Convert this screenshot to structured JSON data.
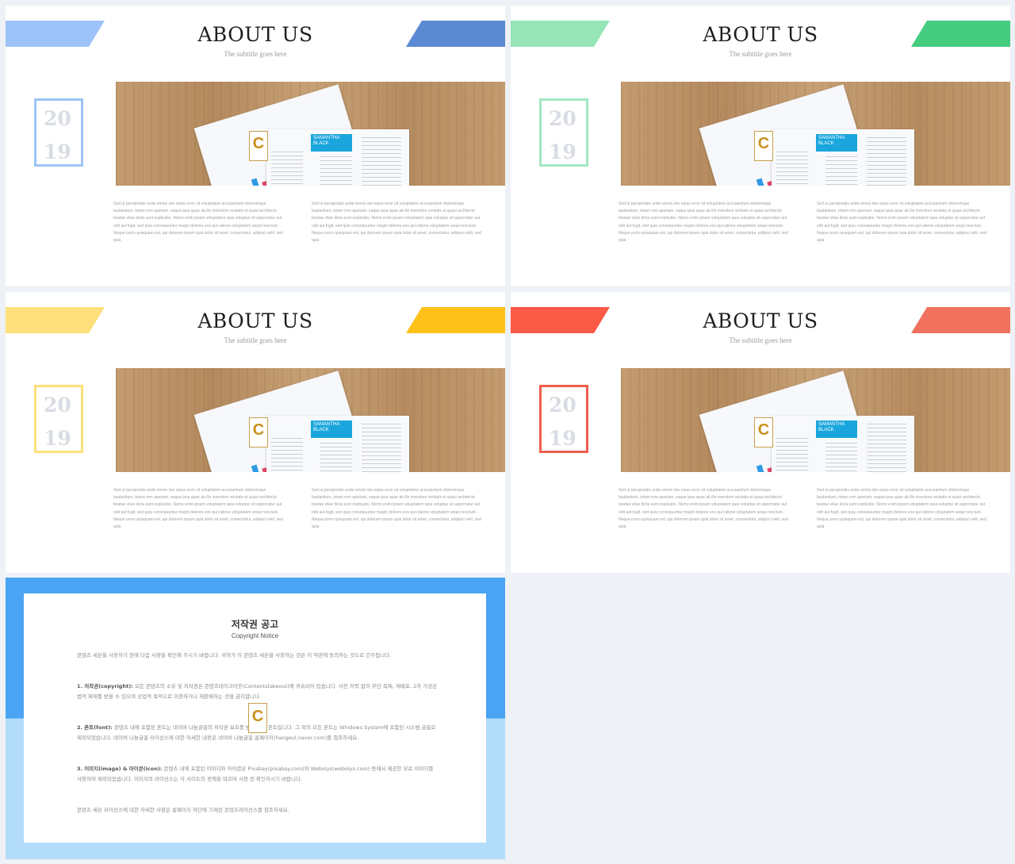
{
  "slides": [
    {
      "title": "ABOUT US",
      "subtitle": "The subtitle goes here",
      "year_top": "20",
      "year_bottom": "19",
      "tab_left_color": "#9ec3f8",
      "tab_right_color": "#5b8ad3",
      "year_border_color": "#9ec3f8"
    },
    {
      "title": "ABOUT US",
      "subtitle": "The subtitle goes here",
      "year_top": "20",
      "year_bottom": "19",
      "tab_left_color": "#96e6b8",
      "tab_right_color": "#45cc7f",
      "year_border_color": "#a3e7c0"
    },
    {
      "title": "ABOUT US",
      "subtitle": "The subtitle goes here",
      "year_top": "20",
      "year_bottom": "19",
      "tab_left_color": "#fde07a",
      "tab_right_color": "#fec11a",
      "year_border_color": "#fde07a"
    },
    {
      "title": "ABOUT US",
      "subtitle": "The subtitle goes here",
      "year_top": "20",
      "year_bottom": "19",
      "tab_left_color": "#fb5a46",
      "tab_right_color": "#f0725e",
      "year_border_color": "#ef5e4c"
    }
  ],
  "photo": {
    "resume_name": "SAMANTHA BLACK",
    "logo_letter": "C"
  },
  "body_text": {
    "left": "Sed ut perspiciatis unde omnis iste natus error sit voluptatem accusantium doloremque laudantium, totam rem aperiam, eaque ipsa quae ab illo inventore veritatis et quasi architecto beatae vitae dicta sunt explicabo. Nemo enim ipsam voluptatem quia voluptas sit aspernatur aut odit aut fugit, sed quia consequuntur magni dolores eos qui ratione voluptatem sequi nesciunt. Neque porro quisquam est, qui dolorem ipsum quia dolor sit amet, consectetur, adipisci velit, sed quia",
    "right": "Sed ut perspiciatis unde omnis iste natus error sit voluptatem accusantium doloremque laudantium, totam rem aperiam, eaque ipsa quae ab illo inventore veritatis et quasi architecto beatae vitae dicta sunt explicabo. Nemo enim ipsam voluptatem quia voluptas sit aspernatur aut odit aut fugit, sed quia consequuntur magni dolores eos qui ratione voluptatem sequi nesciunt. Neque porro quisquam est, qui dolorem ipsum quia dolor sit amet, consectetur, adipisci velit, sed quia"
  },
  "notice": {
    "title": "저작권 공고",
    "subtitle": "Copyright Notice",
    "logo_letter": "C",
    "intro": "콘텐츠 세븐을 사용하기 전에 다음 사항을 확인해 주시기 바랍니다. 귀하가 이 콘텐츠 세븐을 사용하는 것은 이 약관에 동의하는 것으로 간주됩니다.",
    "p1_head": "1. 저작권(copyright):",
    "p1_body": " 모든 콘텐츠의 소유 및 저작권은 콘텐츠테이크아웃(Contentstakeout)에 귀속되어 있습니다. 사전 허락 없이 무단 복제, 재배포, 2차 가공은 법적 제재를 받을 수 있으며 상업적 목적으로 이용하거나 재판매하는 것을 금지합니다.",
    "p2_head": "2. 폰트(font):",
    "p2_body": " 콘텐츠 내에 포함된 폰트는 네이버 나눔글꼴의 저작권 보호를 받는 무료 폰트입니다. 그 외의 모든 폰트는 Windows System에 포함된 시스템 글꼴로 제작되었습니다. 네이버 나눔글꼴 라이선스에 대한 자세한 내용은 네이버 나눔글꼴 홈페이지(hangeul.naver.com)를 참조하세요.",
    "p3_head": "3. 이미지(image) & 아이콘(icon):",
    "p3_body": " 콘텐츠 내에 포함된 이미지와 아이콘은 Pixabay(pixabay.com)와 Webolys(webolys.com) 등에서 제공한 무료 이미지를 사용하여 제작되었습니다. 이미지의 라이선스는 각 사이트의 정책을 따르며 사용 전 확인하시기 바랍니다.",
    "outro": "콘텐츠 세븐 라이선스에 대한 자세한 사항은 홈페이지 하단에 기재된 콘텐츠라이선스를 참조하세요."
  }
}
